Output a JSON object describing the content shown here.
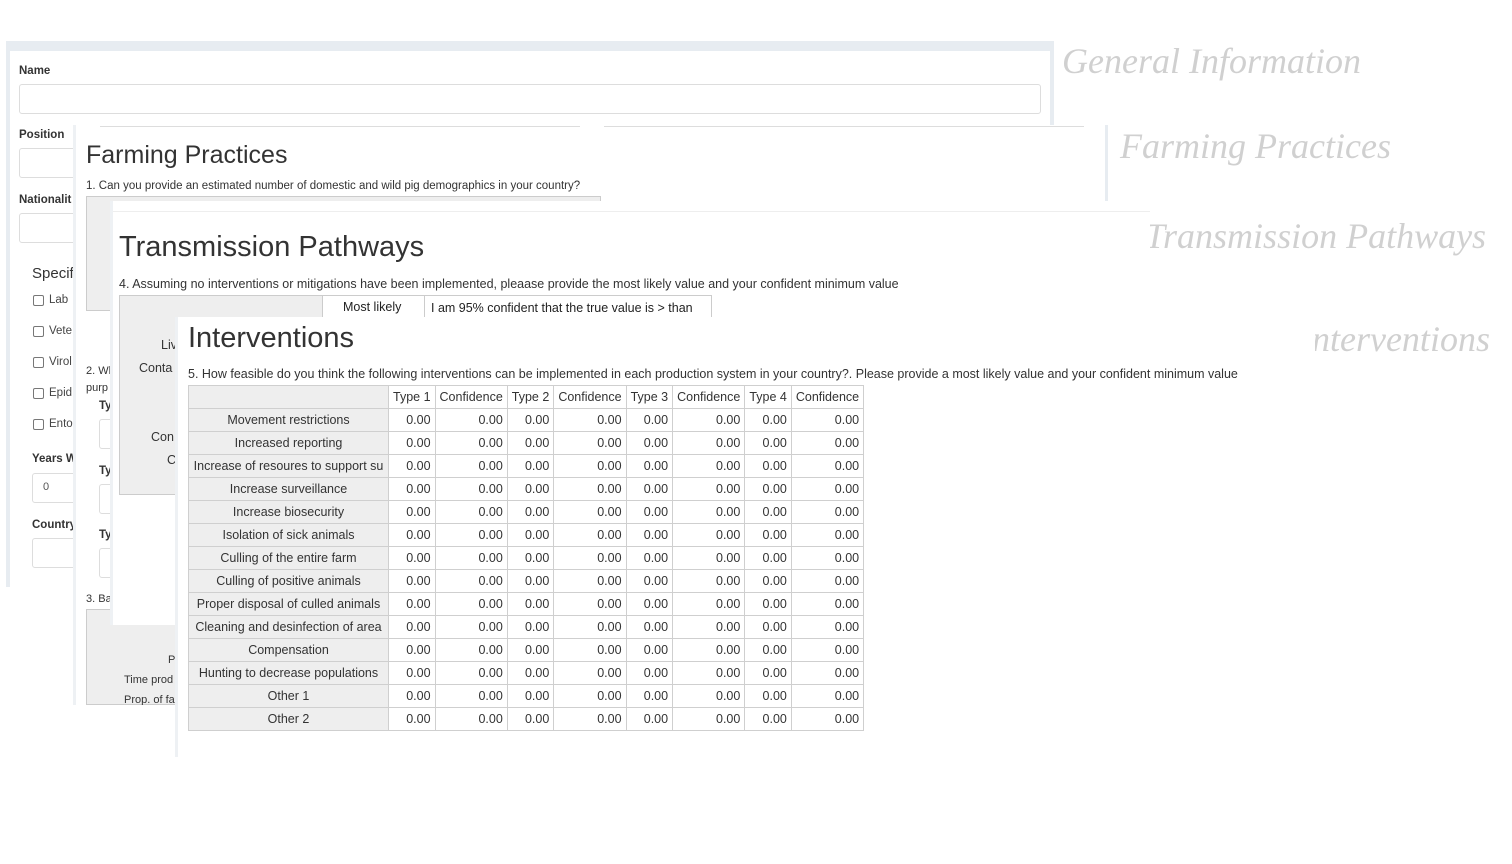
{
  "captions": {
    "general": "General Information",
    "farming": "Farming Practices",
    "transmission": "Transmission Pathways",
    "interventions": "Interventions"
  },
  "general_form": {
    "name_label": "Name",
    "position_label": "Position",
    "nationality_label": "Nationalit",
    "specific_heading": "Specif",
    "checkboxes": [
      "Lab",
      "Vete",
      "Virol",
      "Epid",
      "Ento"
    ],
    "years_label": "Years W",
    "years_value": "0",
    "country_label": "Country"
  },
  "farming": {
    "title": "Farming Practices",
    "q1": "1. Can you provide an estimated number of domestic and wild pig demographics in your country?",
    "q2_line1": "2. Wh",
    "q2_line2": "purp",
    "type_labels": [
      "Ty",
      "Ty",
      "Ty"
    ],
    "q3": "3. Ba",
    "row_fragments": [
      "P",
      "Time prod",
      "Prop. of fa"
    ]
  },
  "transmission": {
    "title": "Transmission Pathways",
    "q4": "4. Assuming no interventions or mitigations have been implemented, pleaase provide the most likely value and your confident minimum value",
    "col_most_likely": "Most likely",
    "col_confident": "I am 95% confident that the true value is > than",
    "row_fragments": [
      "Liv",
      "Conta",
      "Con",
      "C"
    ]
  },
  "interventions": {
    "title": "Interventions",
    "q5": "5. How feasible do you think the following interventions can be implemented in each production system in your country?. Please provide a most likely value and your confident minimum value",
    "columns": [
      "Type 1",
      "Confidence",
      "Type 2",
      "Confidence",
      "Type 3",
      "Confidence",
      "Type 4",
      "Confidence"
    ],
    "rows": [
      {
        "label": "Movement restrictions",
        "values": [
          "0.00",
          "0.00",
          "0.00",
          "0.00",
          "0.00",
          "0.00",
          "0.00",
          "0.00"
        ]
      },
      {
        "label": "Increased reporting",
        "values": [
          "0.00",
          "0.00",
          "0.00",
          "0.00",
          "0.00",
          "0.00",
          "0.00",
          "0.00"
        ]
      },
      {
        "label": "Increase of resoures to support su",
        "values": [
          "0.00",
          "0.00",
          "0.00",
          "0.00",
          "0.00",
          "0.00",
          "0.00",
          "0.00"
        ]
      },
      {
        "label": "Increase surveillance",
        "values": [
          "0.00",
          "0.00",
          "0.00",
          "0.00",
          "0.00",
          "0.00",
          "0.00",
          "0.00"
        ]
      },
      {
        "label": "Increase biosecurity",
        "values": [
          "0.00",
          "0.00",
          "0.00",
          "0.00",
          "0.00",
          "0.00",
          "0.00",
          "0.00"
        ]
      },
      {
        "label": "Isolation of sick animals",
        "values": [
          "0.00",
          "0.00",
          "0.00",
          "0.00",
          "0.00",
          "0.00",
          "0.00",
          "0.00"
        ]
      },
      {
        "label": "Culling of the entire farm",
        "values": [
          "0.00",
          "0.00",
          "0.00",
          "0.00",
          "0.00",
          "0.00",
          "0.00",
          "0.00"
        ]
      },
      {
        "label": "Culling of positive animals",
        "values": [
          "0.00",
          "0.00",
          "0.00",
          "0.00",
          "0.00",
          "0.00",
          "0.00",
          "0.00"
        ]
      },
      {
        "label": "Proper disposal of culled animals",
        "values": [
          "0.00",
          "0.00",
          "0.00",
          "0.00",
          "0.00",
          "0.00",
          "0.00",
          "0.00"
        ]
      },
      {
        "label": "Cleaning and desinfection of area",
        "values": [
          "0.00",
          "0.00",
          "0.00",
          "0.00",
          "0.00",
          "0.00",
          "0.00",
          "0.00"
        ]
      },
      {
        "label": "Compensation",
        "values": [
          "0.00",
          "0.00",
          "0.00",
          "0.00",
          "0.00",
          "0.00",
          "0.00",
          "0.00"
        ]
      },
      {
        "label": "Hunting to decrease populations",
        "values": [
          "0.00",
          "0.00",
          "0.00",
          "0.00",
          "0.00",
          "0.00",
          "0.00",
          "0.00"
        ]
      },
      {
        "label": "Other 1",
        "values": [
          "0.00",
          "0.00",
          "0.00",
          "0.00",
          "0.00",
          "0.00",
          "0.00",
          "0.00"
        ]
      },
      {
        "label": "Other 2",
        "values": [
          "0.00",
          "0.00",
          "0.00",
          "0.00",
          "0.00",
          "0.00",
          "0.00",
          "0.00"
        ]
      }
    ]
  }
}
